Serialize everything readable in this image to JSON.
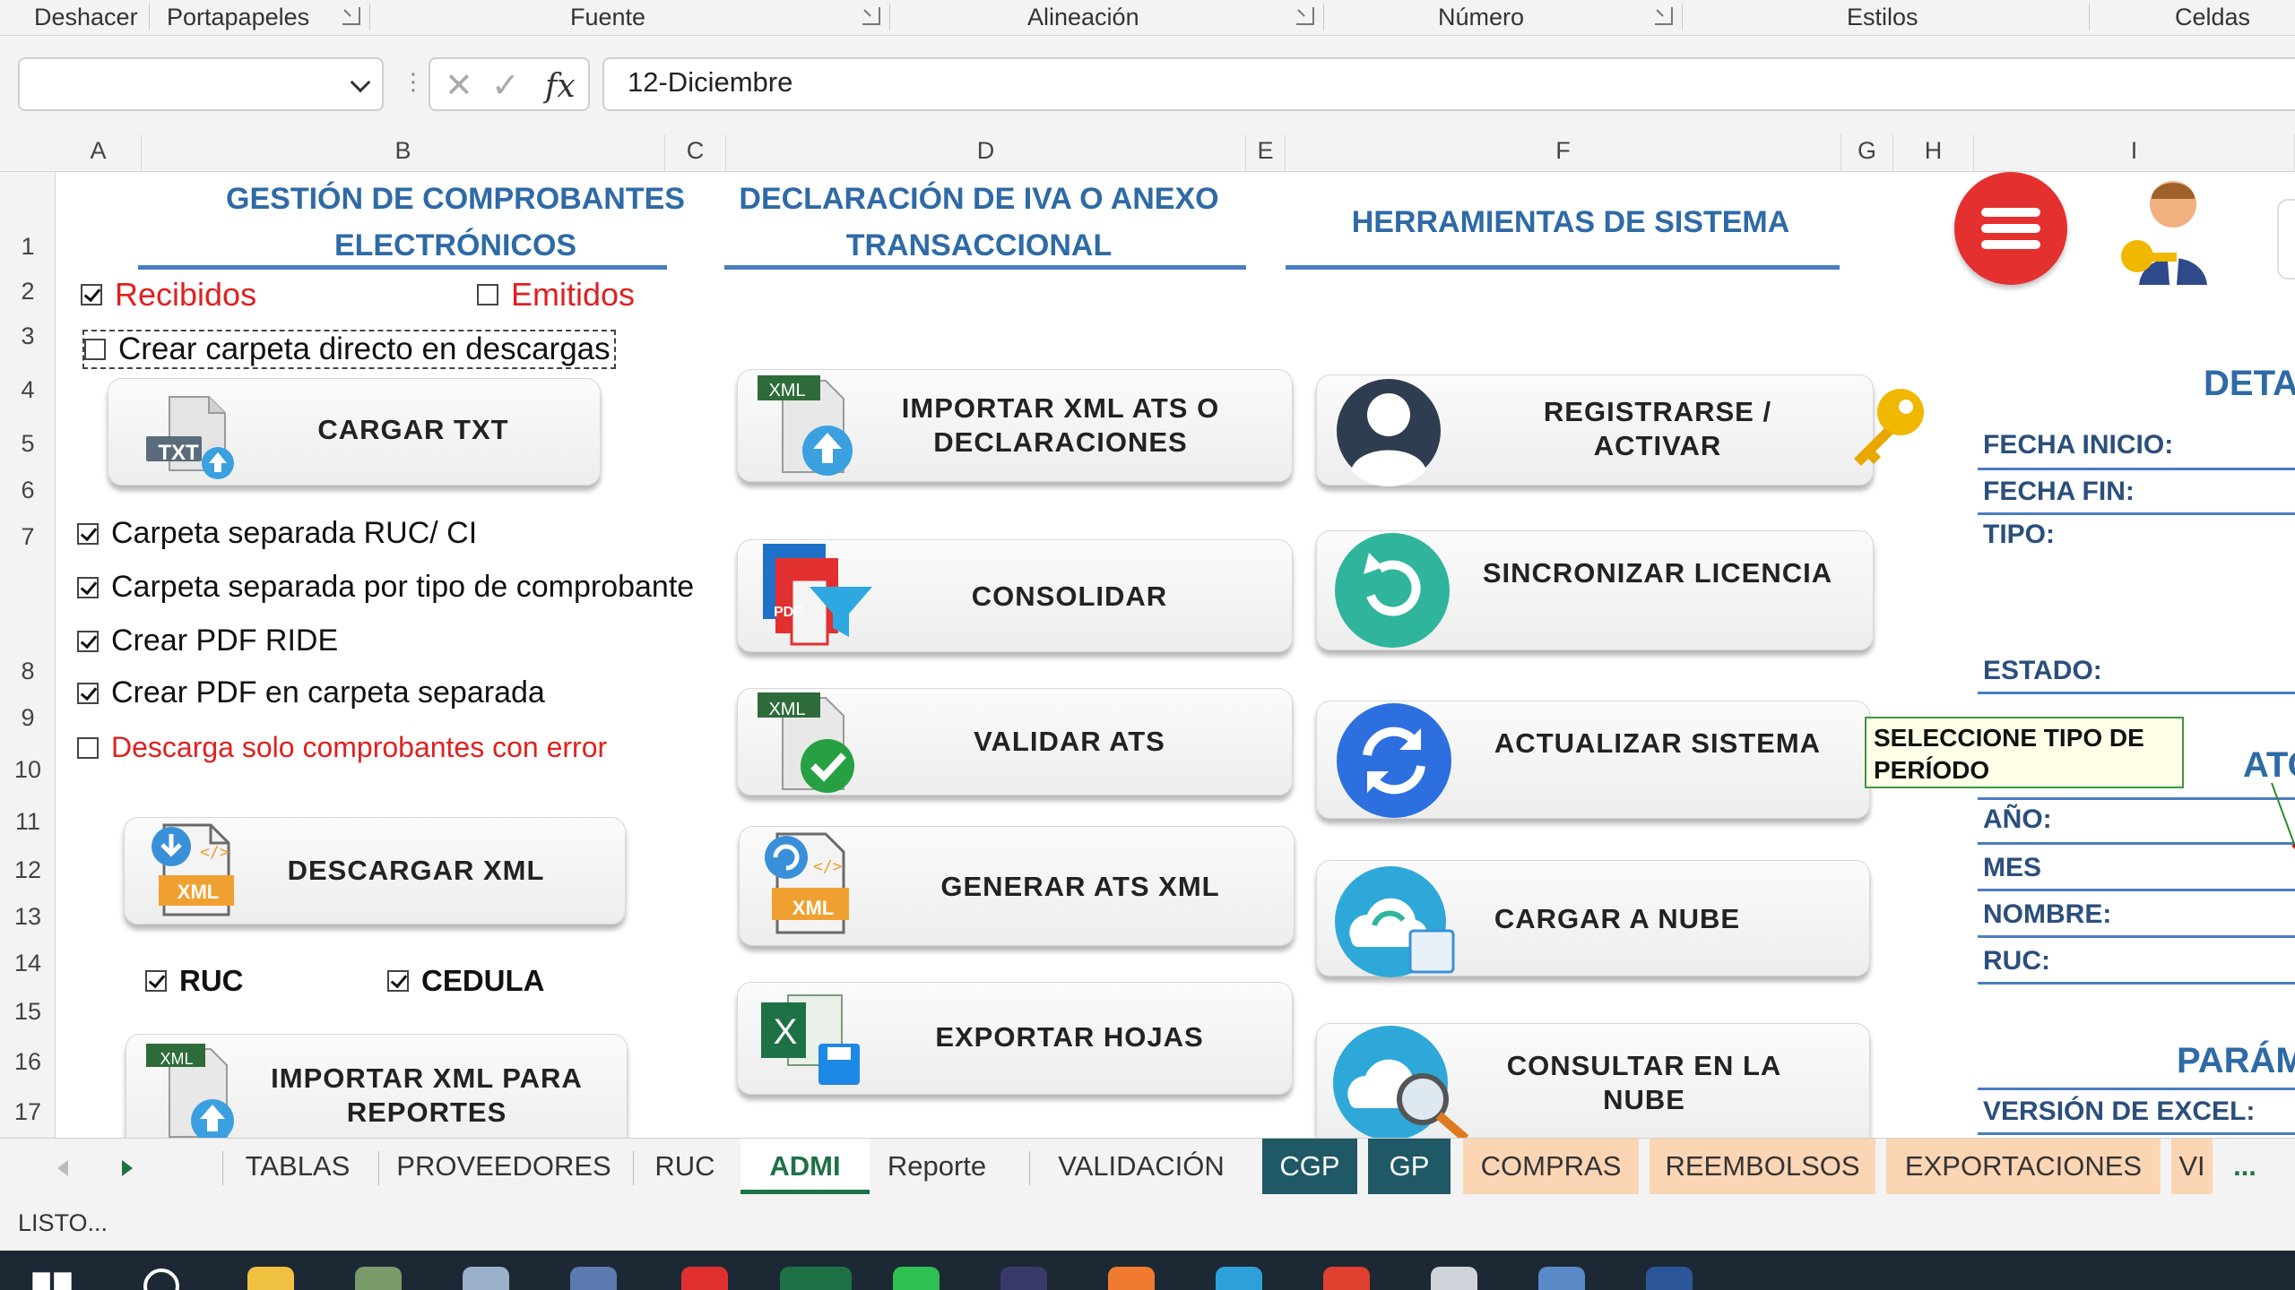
{
  "ribbon": {
    "groups": [
      "Deshacer",
      "Portapapeles",
      "Fuente",
      "Alineación",
      "Número",
      "Estilos",
      "Celdas"
    ]
  },
  "formula_bar": {
    "name_box_value": "",
    "fx_label": "fx",
    "content": "12-Diciembre"
  },
  "columns": [
    "A",
    "B",
    "C",
    "D",
    "E",
    "F",
    "G",
    "H",
    "I"
  ],
  "rows": [
    "1",
    "2",
    "3",
    "4",
    "5",
    "6",
    "7",
    "8",
    "9",
    "10",
    "11",
    "12",
    "13",
    "14",
    "15",
    "16",
    "17"
  ],
  "sections": {
    "comprobantes": "GESTIÓN DE COMPROBANTES ELECTRÓNICOS",
    "iva": "DECLARACIÓN DE IVA O ANEXO TRANSACCIONAL",
    "herramientas": "HERRAMIENTAS DE SISTEMA"
  },
  "checkboxes": {
    "recibidos": "Recibidos",
    "emitidos": "Emitidos",
    "crear_carpeta": "Crear carpeta directo en descargas",
    "carpeta_ruc": "Carpeta separada RUC/ CI",
    "carpeta_tipo": "Carpeta separada por tipo de comprobante",
    "crear_pdf": "Crear PDF RIDE",
    "pdf_separada": "Crear PDF en carpeta separada",
    "solo_error": "Descarga solo comprobantes con error",
    "ruc": "RUC",
    "cedula": "CEDULA"
  },
  "buttons": {
    "cargar_txt": "CARGAR TXT",
    "descargar_xml": "DESCARGAR XML",
    "importar_xml_reportes": "IMPORTAR XML PARA REPORTES",
    "importar_xml_ats": "IMPORTAR XML ATS O DECLARACIONES",
    "consolidar": "CONSOLIDAR",
    "validar_ats": "VALIDAR ATS",
    "generar_ats": "GENERAR ATS XML",
    "exportar_hojas": "EXPORTAR HOJAS",
    "registrarse": "REGISTRARSE / ACTIVAR",
    "sincronizar": "SINCRONIZAR LICENCIA",
    "actualizar": "ACTUALIZAR SISTEMA",
    "cargar_nube": "CARGAR A NUBE",
    "consultar_nube": "CONSULTAR EN LA NUBE"
  },
  "icon_text": {
    "txt": "TXT",
    "xml": "XML",
    "pdf": "PDF",
    "excel": "X"
  },
  "right_panel": {
    "head_deta": "DETA",
    "fecha_inicio": "FECHA INICIO:",
    "fecha_fin": "FECHA FIN:",
    "tipo": "TIPO:",
    "estado": "ESTADO:",
    "head_at": "ATO",
    "anio": "AÑO:",
    "mes": "MES",
    "nombre": "NOMBRE:",
    "ruc": "RUC:",
    "head_param": "PARÁM",
    "version": "VERSIÓN DE EXCEL:"
  },
  "tooltip": "SELECCIONE TIPO DE PERÍODO",
  "tabs": [
    "TABLAS",
    "PROVEEDORES",
    "RUC",
    "ADMI",
    "Reporte",
    "VALIDACIÓN",
    "CGP",
    "GP",
    "COMPRAS",
    "REEMBOLSOS",
    "EXPORTACIONES",
    "VI"
  ],
  "tabs_more": "...",
  "active_tab": "ADMI",
  "status": "LISTO...",
  "colors": {
    "section_title": "#2e6aa6",
    "red_text": "#e02020",
    "excel_green": "#1e7145",
    "tab_teal": "#1f5966",
    "tab_peach": "#fcd5b4"
  }
}
